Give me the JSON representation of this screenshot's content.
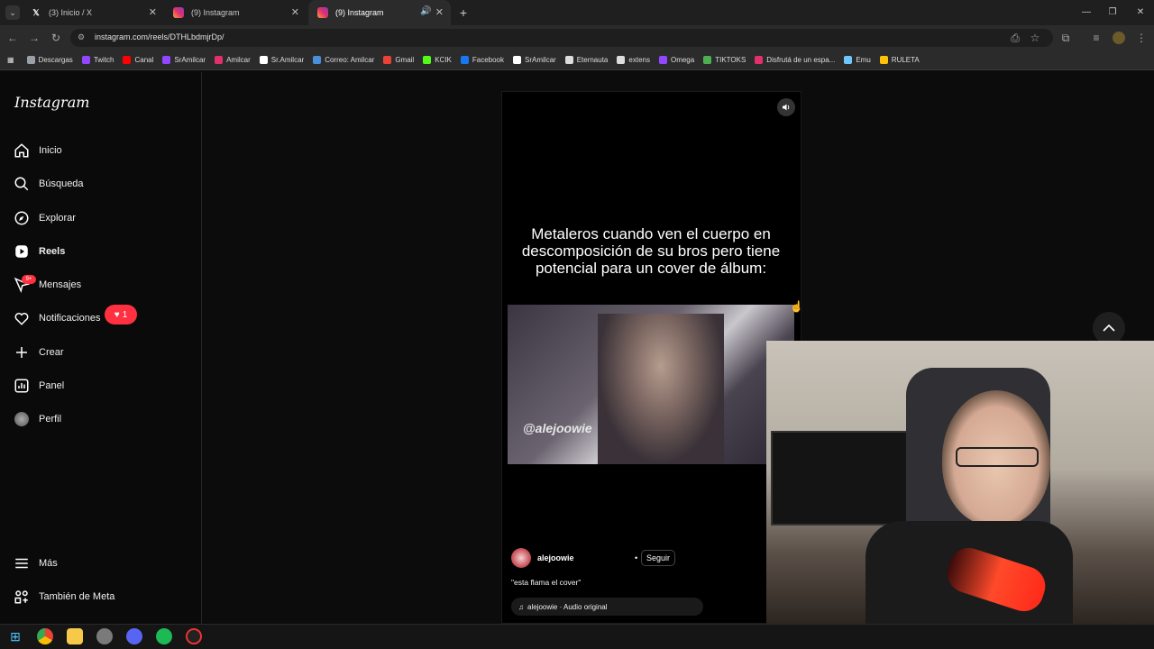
{
  "tabs": [
    {
      "label": "(3) Inicio / X",
      "icon": "x-logo-icon"
    },
    {
      "label": "(9) Instagram",
      "icon": "instagram-icon"
    },
    {
      "label": "(9) Instagram",
      "icon": "instagram-icon",
      "active": true
    }
  ],
  "address": {
    "url": "instagram.com/reels/DTHLbdmjrDp/"
  },
  "bookmarks": [
    {
      "label": "Descargas",
      "color": "#9aa0a6"
    },
    {
      "label": "Twitch",
      "color": "#9146ff"
    },
    {
      "label": "Canal",
      "color": "#ff0000"
    },
    {
      "label": "SrAmilcar",
      "color": "#9146ff"
    },
    {
      "label": "Amilcar",
      "color": "#e1306c"
    },
    {
      "label": "Sr.Amilcar",
      "color": "#ffffff"
    },
    {
      "label": "Correo: Amilcar",
      "color": "#4a90d9"
    },
    {
      "label": "Gmail",
      "color": "#ea4335"
    },
    {
      "label": "KCIK",
      "color": "#53fc18"
    },
    {
      "label": "Facebook",
      "color": "#1877f2"
    },
    {
      "label": "SrAmilcar",
      "color": "#ffffff"
    },
    {
      "label": "Eternauta",
      "color": "#dddddd"
    },
    {
      "label": "extens",
      "color": "#dddddd"
    },
    {
      "label": "Omega",
      "color": "#9146ff"
    },
    {
      "label": "TIKTOKS",
      "color": "#4caf50"
    },
    {
      "label": "Disfrutá de un espa...",
      "color": "#e1306c"
    },
    {
      "label": "Emu",
      "color": "#6ec6ff"
    },
    {
      "label": "RULETA",
      "color": "#ffc107"
    }
  ],
  "sidebar": {
    "logo": "Instagram",
    "items": [
      {
        "label": "Inicio",
        "icon": "home-icon"
      },
      {
        "label": "Búsqueda",
        "icon": "search-icon"
      },
      {
        "label": "Explorar",
        "icon": "compass-icon"
      },
      {
        "label": "Reels",
        "icon": "reels-icon"
      },
      {
        "label": "Mensajes",
        "icon": "messages-icon"
      },
      {
        "label": "Notificaciones",
        "icon": "heart-icon"
      },
      {
        "label": "Crear",
        "icon": "plus-icon"
      },
      {
        "label": "Panel",
        "icon": "chart-icon"
      },
      {
        "label": "Perfil",
        "icon": "avatar"
      }
    ],
    "bottom": [
      {
        "label": "Más",
        "icon": "menu-icon"
      },
      {
        "label": "También de Meta",
        "icon": "meta-icon"
      }
    ],
    "messages_badge": "9+",
    "notifications_badge": "1"
  },
  "reel": {
    "overlay_text": "Metaleros cuando ven el cuerpo en descomposición de su bros pero tiene potencial para un cover de álbum:",
    "watermark": "@alejoowie",
    "username": "alejoowie",
    "follow_label": "Seguir",
    "caption": "\"esta flama el cover\"",
    "audio": "alejoowie · Audio original"
  }
}
